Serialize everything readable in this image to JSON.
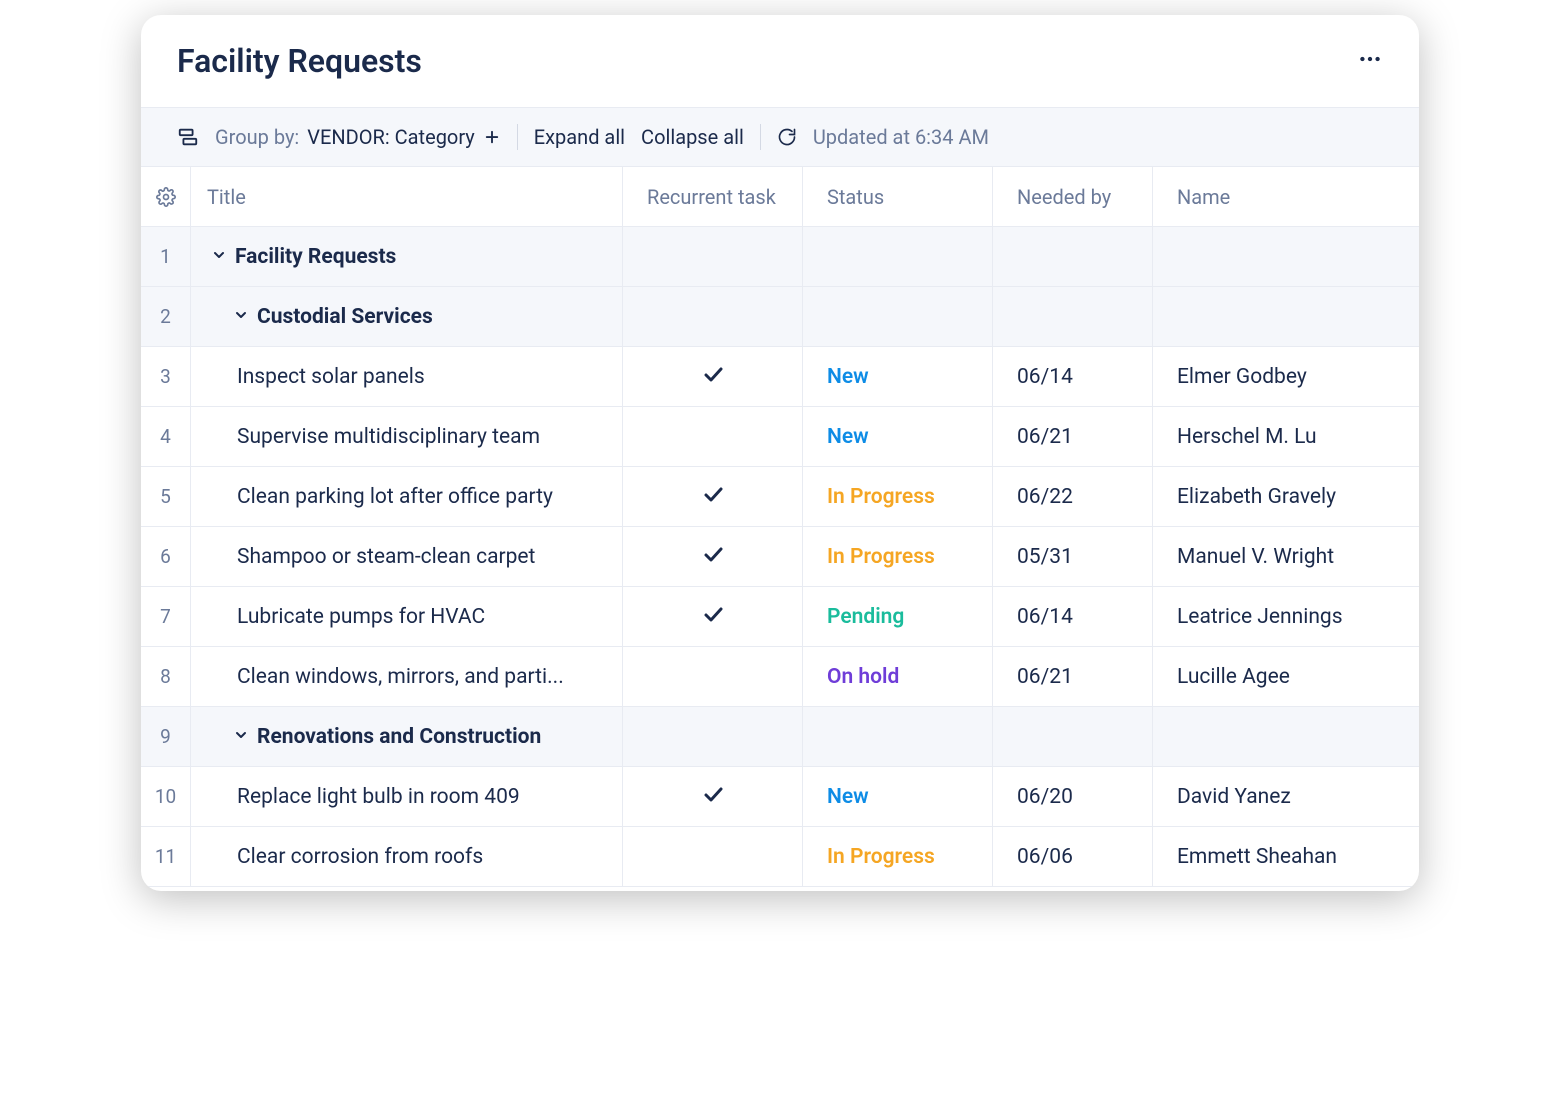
{
  "header": {
    "title": "Facility Requests"
  },
  "toolbar": {
    "group_by_label": "Group by:",
    "group_by_value": "VENDOR: Category",
    "expand_all": "Expand all",
    "collapse_all": "Collapse all",
    "updated_text": "Updated at 6:34 AM"
  },
  "columns": {
    "title": "Title",
    "recurrent": "Recurrent task",
    "status": "Status",
    "needed_by": "Needed by",
    "name": "Name"
  },
  "groups": {
    "top": "Facility Requests",
    "sub1": "Custodial Services",
    "sub2": "Renovations and Construction"
  },
  "rows": [
    {
      "num": "3",
      "title": "Inspect solar panels",
      "recurrent": true,
      "status": "New",
      "status_class": "New",
      "needed": "06/14",
      "name": "Elmer Godbey"
    },
    {
      "num": "4",
      "title": "Supervise multidisciplinary team",
      "recurrent": false,
      "status": "New",
      "status_class": "New",
      "needed": "06/21",
      "name": "Herschel M. Lu"
    },
    {
      "num": "5",
      "title": "Clean parking lot after office party",
      "recurrent": true,
      "status": "In Progress",
      "status_class": "InProgress",
      "needed": "06/22",
      "name": "Elizabeth Gravely"
    },
    {
      "num": "6",
      "title": "Shampoo or steam-clean carpet",
      "recurrent": true,
      "status": "In Progress",
      "status_class": "InProgress",
      "needed": "05/31",
      "name": "Manuel V. Wright"
    },
    {
      "num": "7",
      "title": "Lubricate pumps for HVAC",
      "recurrent": true,
      "status": "Pending",
      "status_class": "Pending",
      "needed": "06/14",
      "name": "Leatrice Jennings"
    },
    {
      "num": "8",
      "title": "Clean windows, mirrors, and parti...",
      "recurrent": false,
      "status": "On hold",
      "status_class": "Onhold",
      "needed": "06/21",
      "name": "Lucille Agee"
    },
    {
      "num": "10",
      "title": "Replace light bulb in room 409",
      "recurrent": true,
      "status": "New",
      "status_class": "New",
      "needed": "06/20",
      "name": "David Yanez"
    },
    {
      "num": "11",
      "title": "Clear corrosion from roofs",
      "recurrent": false,
      "status": "In Progress",
      "status_class": "InProgress",
      "needed": "06/06",
      "name": "Emmett Sheahan"
    }
  ],
  "row_nums": {
    "top": "1",
    "sub1": "2",
    "sub2": "9"
  }
}
